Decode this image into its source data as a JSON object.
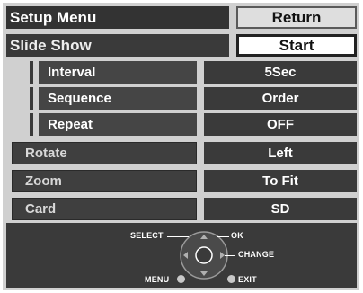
{
  "header": {
    "title": "Setup Menu",
    "return_label": "Return"
  },
  "slideshow": {
    "label": "Slide Show",
    "action_label": "Start"
  },
  "sub_settings": [
    {
      "label": "Interval",
      "value": "5Sec"
    },
    {
      "label": "Sequence",
      "value": "Order"
    },
    {
      "label": "Repeat",
      "value": "OFF"
    }
  ],
  "main_settings": [
    {
      "label": "Rotate",
      "value": "Left"
    },
    {
      "label": "Zoom",
      "value": "To Fit"
    },
    {
      "label": "Card",
      "value": "SD"
    }
  ],
  "nav_legend": {
    "select": "SELECT",
    "ok": "OK",
    "change": "CHANGE",
    "menu": "MENU",
    "exit": "EXIT"
  },
  "colors": {
    "screen_background": "#d0d0d0",
    "bar_dark": "#3a3a3a",
    "highlight_light": "#dedede"
  },
  "icons": [
    "navigation-pad-icon",
    "menu-button-icon",
    "exit-button-icon"
  ]
}
